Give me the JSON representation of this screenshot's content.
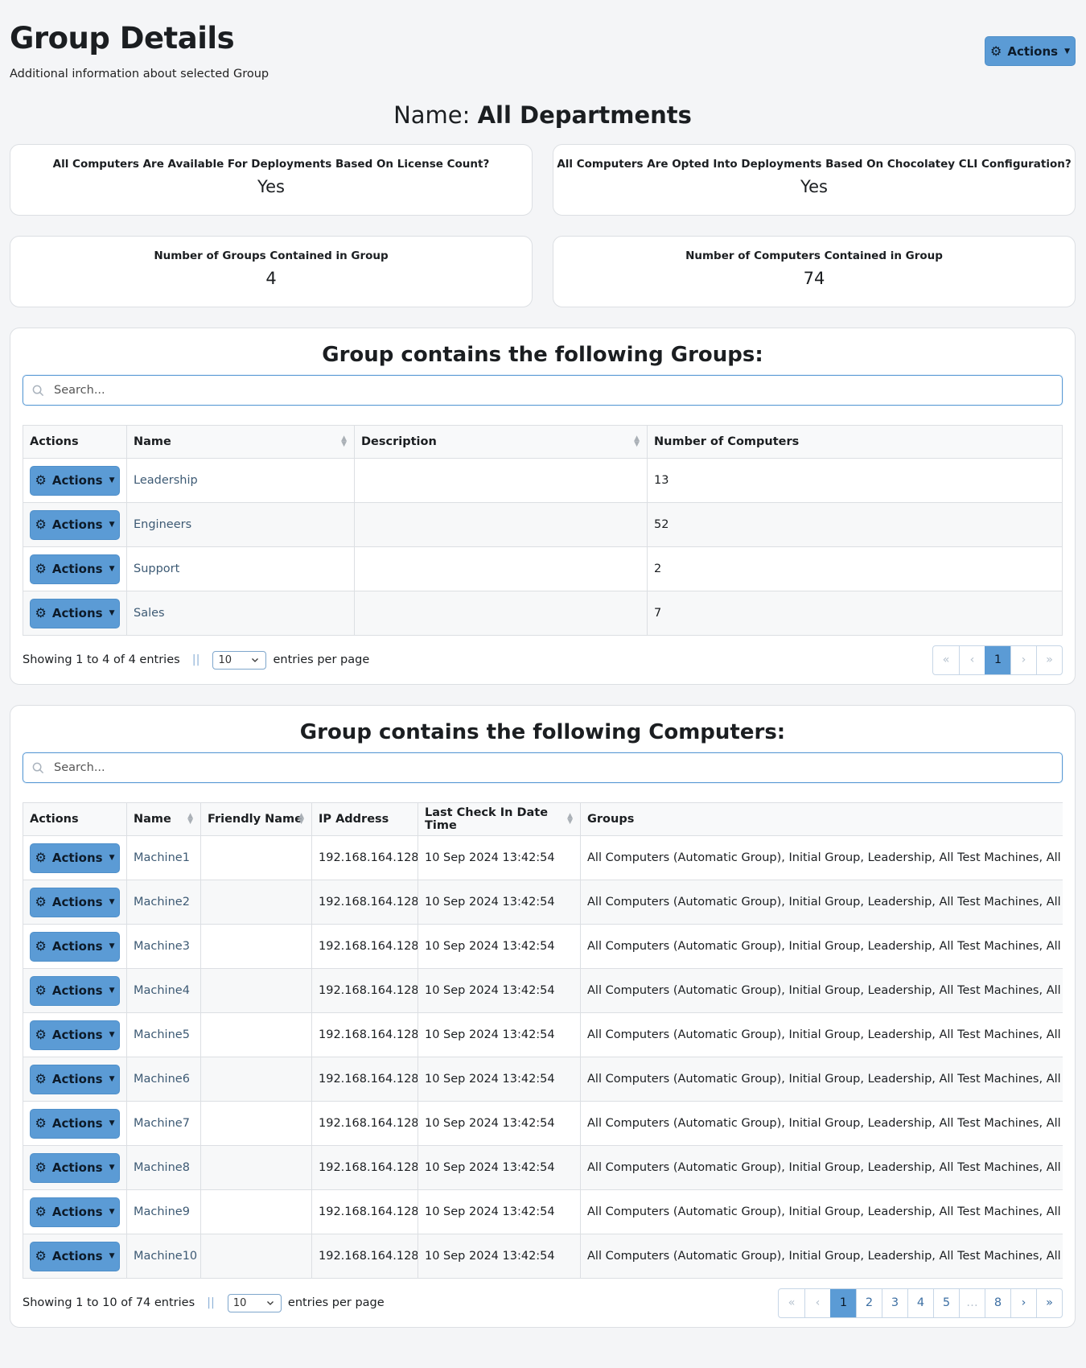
{
  "header": {
    "title": "Group Details",
    "subtitle": "Additional information about selected Group",
    "actions_label": "Actions"
  },
  "group": {
    "name_prefix": "Name:",
    "name": "All Departments"
  },
  "stats": [
    {
      "label": "All Computers Are Available For Deployments Based On License Count?",
      "value": "Yes"
    },
    {
      "label": "All Computers Are Opted Into Deployments Based On Chocolatey CLI Configuration?",
      "value": "Yes"
    },
    {
      "label": "Number of Groups Contained in Group",
      "value": "4"
    },
    {
      "label": "Number of Computers Contained in Group",
      "value": "74"
    }
  ],
  "groups_panel": {
    "title": "Group contains the following Groups:",
    "search_placeholder": "Search...",
    "columns": [
      "Actions",
      "Name",
      "Description",
      "Number of Computers"
    ],
    "rows": [
      {
        "action": "Actions",
        "name": "Leadership",
        "description": "",
        "computers": "13"
      },
      {
        "action": "Actions",
        "name": "Engineers",
        "description": "",
        "computers": "52"
      },
      {
        "action": "Actions",
        "name": "Support",
        "description": "",
        "computers": "2"
      },
      {
        "action": "Actions",
        "name": "Sales",
        "description": "",
        "computers": "7"
      }
    ],
    "showing": "Showing 1 to 4 of 4 entries",
    "separator": "||",
    "per_page_value": "10",
    "per_page_label": "entries per page",
    "pager": [
      "«",
      "‹",
      "1",
      "›",
      "»"
    ]
  },
  "computers_panel": {
    "title": "Group contains the following Computers:",
    "search_placeholder": "Search...",
    "columns": [
      "Actions",
      "Name",
      "Friendly Name",
      "IP Address",
      "Last Check In Date Time",
      "Groups"
    ],
    "rows": [
      {
        "action": "Actions",
        "name": "Machine1",
        "friendly": "",
        "ip": "192.168.164.128",
        "checkin": "10 Sep 2024 13:42:54",
        "groups": "All Computers (Automatic Group), Initial Group, Leadership, All Test Machines, All Departments"
      },
      {
        "action": "Actions",
        "name": "Machine2",
        "friendly": "",
        "ip": "192.168.164.128",
        "checkin": "10 Sep 2024 13:42:54",
        "groups": "All Computers (Automatic Group), Initial Group, Leadership, All Test Machines, All Departments"
      },
      {
        "action": "Actions",
        "name": "Machine3",
        "friendly": "",
        "ip": "192.168.164.128",
        "checkin": "10 Sep 2024 13:42:54",
        "groups": "All Computers (Automatic Group), Initial Group, Leadership, All Test Machines, All Departments"
      },
      {
        "action": "Actions",
        "name": "Machine4",
        "friendly": "",
        "ip": "192.168.164.128",
        "checkin": "10 Sep 2024 13:42:54",
        "groups": "All Computers (Automatic Group), Initial Group, Leadership, All Test Machines, All Departments"
      },
      {
        "action": "Actions",
        "name": "Machine5",
        "friendly": "",
        "ip": "192.168.164.128",
        "checkin": "10 Sep 2024 13:42:54",
        "groups": "All Computers (Automatic Group), Initial Group, Leadership, All Test Machines, All Departments"
      },
      {
        "action": "Actions",
        "name": "Machine6",
        "friendly": "",
        "ip": "192.168.164.128",
        "checkin": "10 Sep 2024 13:42:54",
        "groups": "All Computers (Automatic Group), Initial Group, Leadership, All Test Machines, All Departments"
      },
      {
        "action": "Actions",
        "name": "Machine7",
        "friendly": "",
        "ip": "192.168.164.128",
        "checkin": "10 Sep 2024 13:42:54",
        "groups": "All Computers (Automatic Group), Initial Group, Leadership, All Test Machines, All Departments"
      },
      {
        "action": "Actions",
        "name": "Machine8",
        "friendly": "",
        "ip": "192.168.164.128",
        "checkin": "10 Sep 2024 13:42:54",
        "groups": "All Computers (Automatic Group), Initial Group, Leadership, All Test Machines, All Departments"
      },
      {
        "action": "Actions",
        "name": "Machine9",
        "friendly": "",
        "ip": "192.168.164.128",
        "checkin": "10 Sep 2024 13:42:54",
        "groups": "All Computers (Automatic Group), Initial Group, Leadership, All Test Machines, All Departments"
      },
      {
        "action": "Actions",
        "name": "Machine10",
        "friendly": "",
        "ip": "192.168.164.128",
        "checkin": "10 Sep 2024 13:42:54",
        "groups": "All Computers (Automatic Group), Initial Group, Leadership, All Test Machines, All Departments"
      }
    ],
    "showing": "Showing 1 to 10 of 74 entries",
    "separator": "||",
    "per_page_value": "10",
    "per_page_label": "entries per page",
    "pager": [
      "«",
      "‹",
      "1",
      "2",
      "3",
      "4",
      "5",
      "…",
      "8",
      "›",
      "»"
    ]
  },
  "icons": {
    "actions": "gear-icon",
    "dropdown": "caret-down-icon",
    "search": "search-icon",
    "select": "chevron-down-icon"
  },
  "colors": {
    "accent": "#5b9bd5",
    "background": "#f4f5f7",
    "link": "#3d5a74"
  }
}
